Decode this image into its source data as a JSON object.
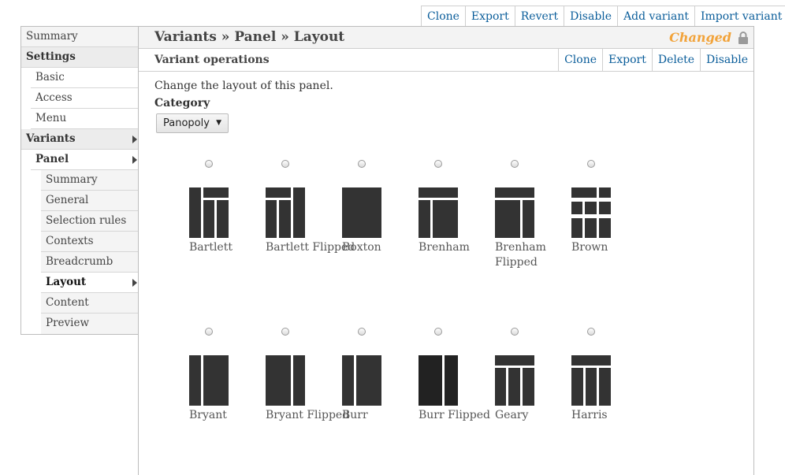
{
  "top_actions": [
    "Clone",
    "Export",
    "Revert",
    "Disable",
    "Add variant",
    "Import variant"
  ],
  "sidebar": {
    "items": [
      {
        "label": "Summary",
        "level": 0,
        "bold": false,
        "arrow": false,
        "active": false
      },
      {
        "label": "Settings",
        "level": 0,
        "bold": true,
        "arrow": false,
        "active": false
      },
      {
        "label": "Basic",
        "level": 1,
        "bold": false,
        "arrow": false,
        "active": false
      },
      {
        "label": "Access",
        "level": 1,
        "bold": false,
        "arrow": false,
        "active": false
      },
      {
        "label": "Menu",
        "level": 1,
        "bold": false,
        "arrow": false,
        "active": false
      },
      {
        "label": "Variants",
        "level": 0,
        "bold": true,
        "arrow": true,
        "active": false
      },
      {
        "label": "Panel",
        "level": 1,
        "bold": true,
        "arrow": true,
        "active": false
      },
      {
        "label": "Summary",
        "level": 2,
        "bold": false,
        "arrow": false,
        "active": false
      },
      {
        "label": "General",
        "level": 2,
        "bold": false,
        "arrow": false,
        "active": false
      },
      {
        "label": "Selection rules",
        "level": 2,
        "bold": false,
        "arrow": false,
        "active": false
      },
      {
        "label": "Contexts",
        "level": 2,
        "bold": false,
        "arrow": false,
        "active": false
      },
      {
        "label": "Breadcrumb",
        "level": 2,
        "bold": false,
        "arrow": false,
        "active": false
      },
      {
        "label": "Layout",
        "level": 2,
        "bold": true,
        "arrow": true,
        "active": true
      },
      {
        "label": "Content",
        "level": 2,
        "bold": false,
        "arrow": false,
        "active": false
      },
      {
        "label": "Preview",
        "level": 2,
        "bold": false,
        "arrow": false,
        "active": false
      }
    ]
  },
  "header": {
    "title": "Variants » Panel » Layout",
    "status": "Changed",
    "status_color": "#f2a33a",
    "lock_icon": "lock-icon"
  },
  "variant": {
    "title": "Variant operations",
    "actions": [
      "Clone",
      "Export",
      "Delete",
      "Disable"
    ]
  },
  "intro": "Change the layout of this panel.",
  "category": {
    "label": "Category",
    "selected": "Panopoly"
  },
  "layouts": [
    {
      "name": "Bartlett",
      "icon": "bartlett"
    },
    {
      "name": "Bartlett Flipped",
      "icon": "bartlett-flipped"
    },
    {
      "name": "Boxton",
      "icon": "boxton"
    },
    {
      "name": "Brenham",
      "icon": "brenham"
    },
    {
      "name": "Brenham Flipped",
      "icon": "brenham-flipped"
    },
    {
      "name": "Brown",
      "icon": "brown"
    },
    {
      "name": "Bryant",
      "icon": "bryant"
    },
    {
      "name": "Bryant Flipped",
      "icon": "bryant-flipped"
    },
    {
      "name": "Burr",
      "icon": "burr"
    },
    {
      "name": "Burr Flipped",
      "icon": "burr-flipped"
    },
    {
      "name": "Geary",
      "icon": "geary"
    },
    {
      "name": "Harris",
      "icon": "harris"
    }
  ]
}
